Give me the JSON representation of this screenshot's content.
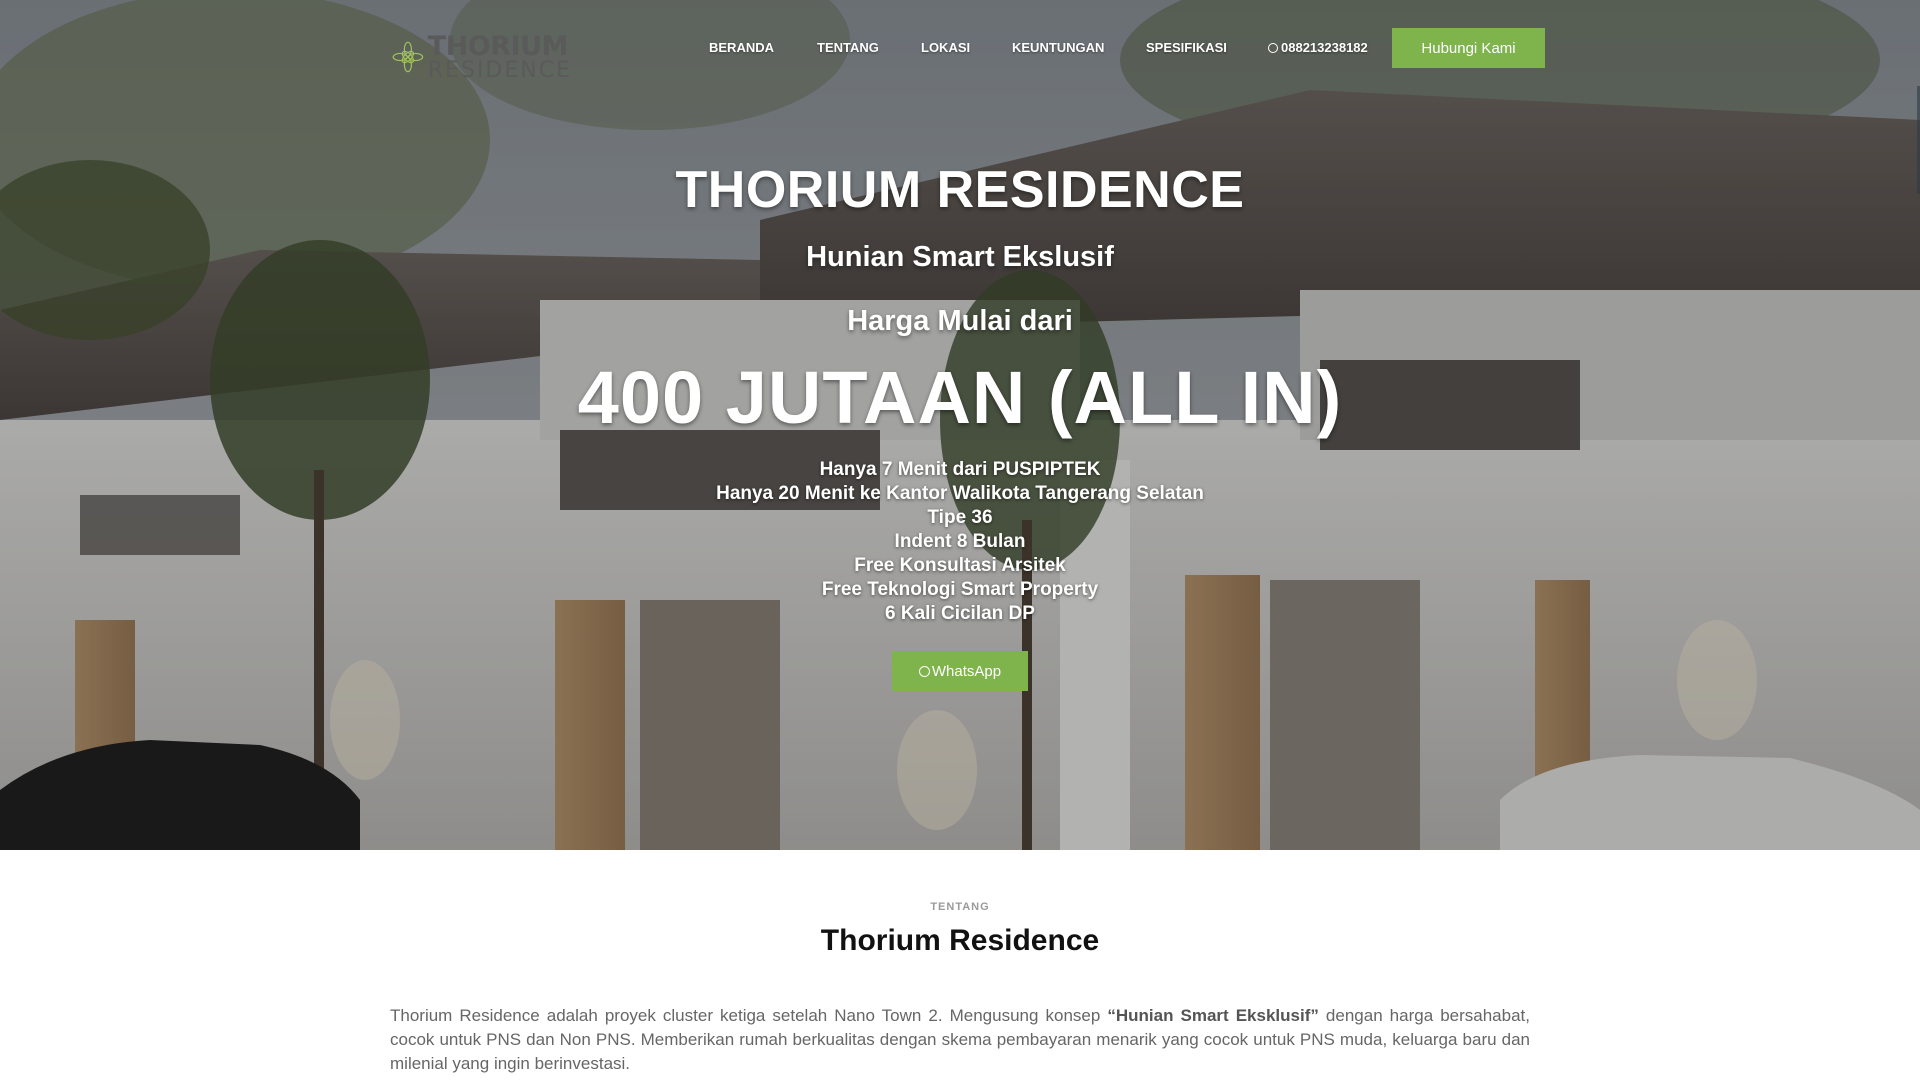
{
  "brand": {
    "name_line1": "THORIUM",
    "name_line2": "RESIDENCE",
    "logo_icon": "leaf-flower-icon",
    "accent_color": "#7fb34b"
  },
  "nav": {
    "items": [
      {
        "label": "BERANDA"
      },
      {
        "label": "TENTANG"
      },
      {
        "label": "LOKASI"
      },
      {
        "label": "KEUNTUNGAN"
      },
      {
        "label": "SPESIFIKASI"
      }
    ],
    "phone": "088213238182",
    "phone_icon": "whatsapp-icon",
    "cta_label": "Hubungi Kami"
  },
  "hero": {
    "title": "THORIUM RESIDENCE",
    "subtitle": "Hunian Smart Ekslusif",
    "price_label": "Harga Mulai dari",
    "price": "400 JUTAAN (ALL IN)",
    "features": [
      "Hanya 7 Menit dari PUSPIPTEK",
      "Hanya 20 Menit ke Kantor Walikota Tangerang Selatan",
      "Tipe 36",
      "Indent 8 Bulan",
      "Free Konsultasi Arsitek",
      "Free Teknologi Smart Property",
      "6 Kali Cicilan DP"
    ],
    "whatsapp_label": "WhatsApp",
    "whatsapp_icon": "whatsapp-icon"
  },
  "about": {
    "kicker": "TENTANG",
    "title": "Thorium Residence",
    "body_before": "Thorium Residence adalah proyek cluster ketiga setelah Nano Town 2. Mengusung konsep ",
    "body_highlight": "“Hunian Smart Eksklusif”",
    "body_after": " dengan harga bersahabat, cocok untuk PNS dan Non PNS. Memberikan rumah berkualitas dengan skema pembayaran menarik yang cocok untuk PNS muda, keluarga baru dan milenial yang ingin berinvestasi."
  }
}
